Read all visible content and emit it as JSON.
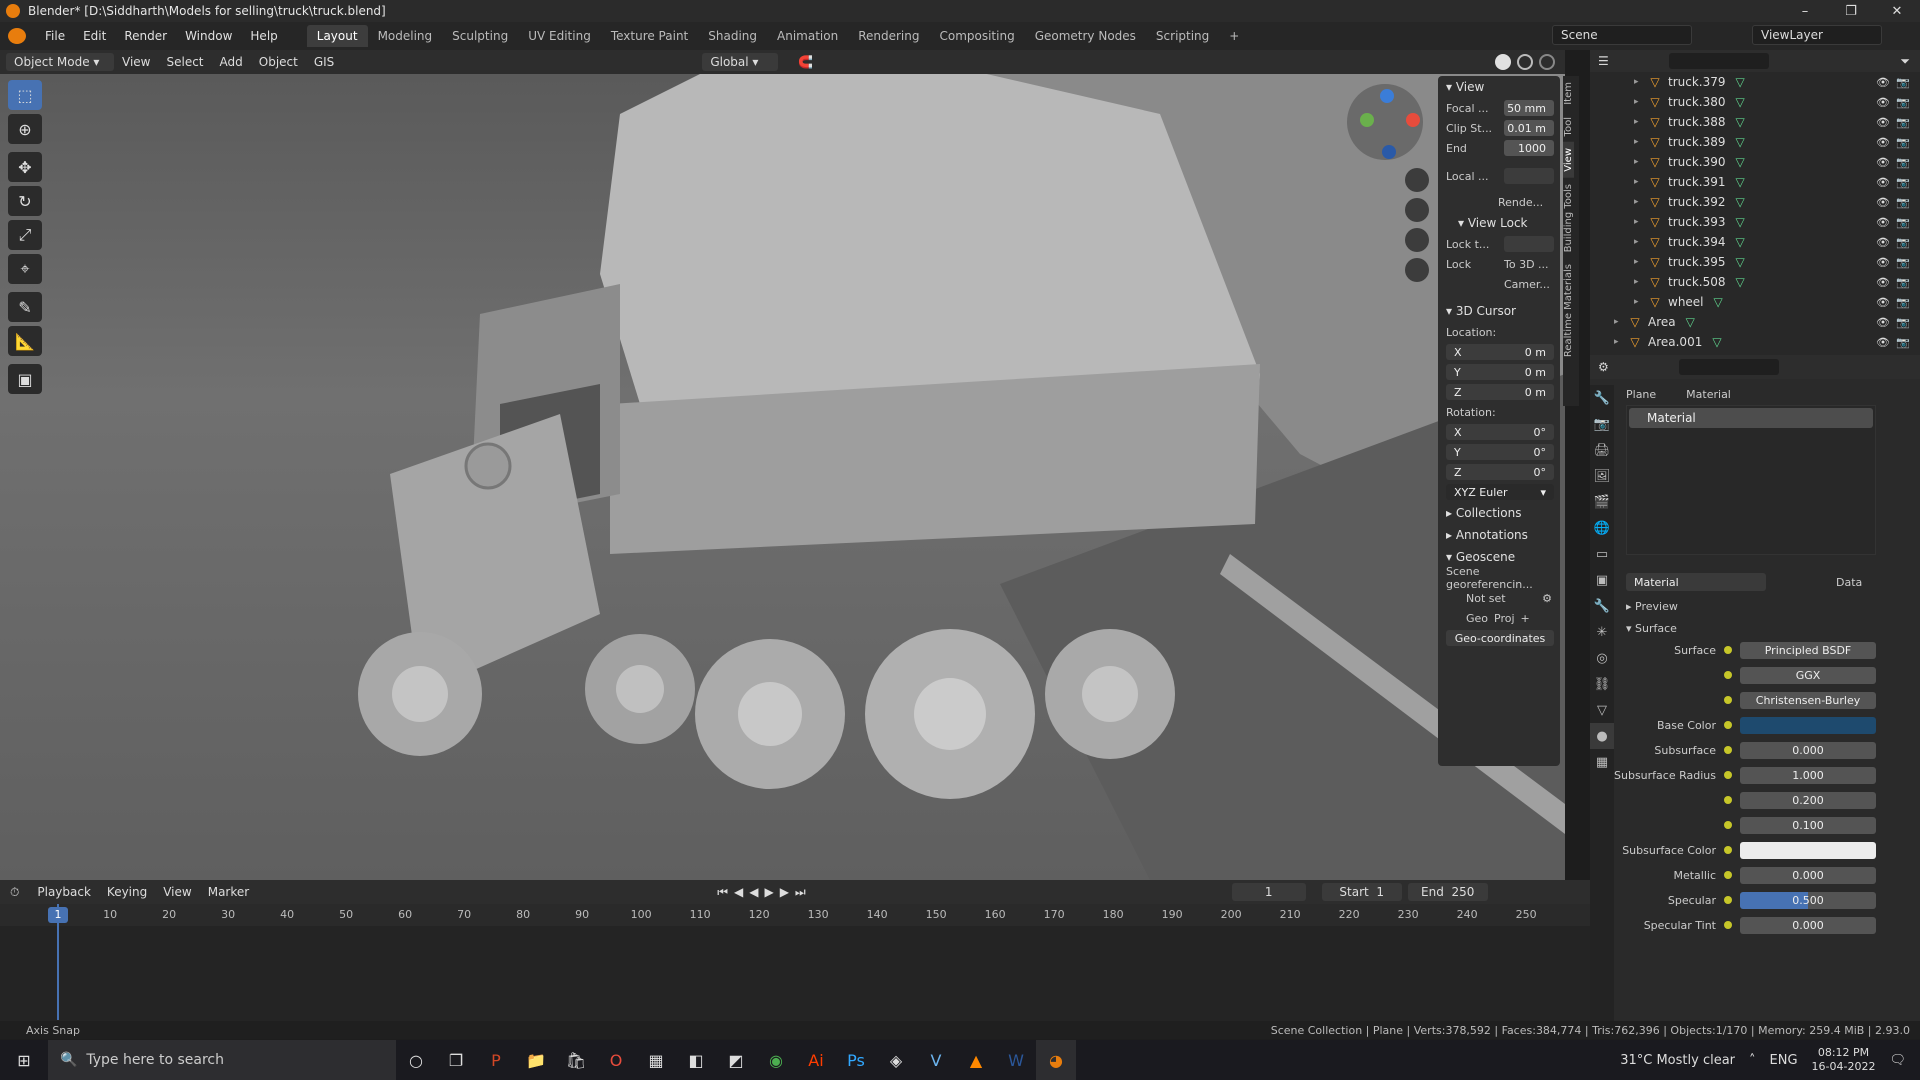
{
  "window": {
    "title": "Blender* [D:\\Siddharth\\Models for selling\\truck\\truck.blend]",
    "minimize": "–",
    "maximize": "❐",
    "close": "✕"
  },
  "menu": [
    "File",
    "Edit",
    "Render",
    "Window",
    "Help"
  ],
  "workspaces": [
    "Layout",
    "Modeling",
    "Sculpting",
    "UV Editing",
    "Texture Paint",
    "Shading",
    "Animation",
    "Rendering",
    "Compositing",
    "Geometry Nodes",
    "Scripting",
    "+"
  ],
  "scene": "Scene",
  "view_layer": "ViewLayer",
  "viewport_header": {
    "mode": "Object Mode",
    "items": [
      "View",
      "Select",
      "Add",
      "Object",
      "GIS"
    ],
    "orientation": "Global"
  },
  "npanel": {
    "view_title": "View",
    "focal_label": "Focal ...",
    "focal": "50 mm",
    "clip_start_label": "Clip St...",
    "clip_start": "0.01 m",
    "end_label": "End",
    "end": "1000",
    "local_label": "Local ...",
    "render_label": "Rende...",
    "view_lock_title": "View Lock",
    "lock_to_label": "Lock t...",
    "lock_label": "Lock",
    "to3d": "To 3D ...",
    "camera": "Camer...",
    "cursor_title": "3D Cursor",
    "location_label": "Location:",
    "x": "X",
    "y": "Y",
    "z": "Z",
    "loc_x": "0 m",
    "loc_y": "0 m",
    "loc_z": "0 m",
    "rotation_label": "Rotation:",
    "rot_x": "0°",
    "rot_y": "0°",
    "rot_z": "0°",
    "euler": "XYZ Euler",
    "collections": "Collections",
    "annotations": "Annotations",
    "geoscene": "Geoscene",
    "georef": "Scene georeferencin...",
    "notset": "Not set",
    "geo": "Geo",
    "proj": "Proj",
    "geocoords": "Geo-coordinates"
  },
  "sidetabs": [
    "Item",
    "Tool",
    "View",
    "Building Tools",
    "Realtime Materials"
  ],
  "outliner": [
    {
      "name": "truck.379"
    },
    {
      "name": "truck.380"
    },
    {
      "name": "truck.388"
    },
    {
      "name": "truck.389"
    },
    {
      "name": "truck.390"
    },
    {
      "name": "truck.391"
    },
    {
      "name": "truck.392"
    },
    {
      "name": "truck.393"
    },
    {
      "name": "truck.394"
    },
    {
      "name": "truck.395"
    },
    {
      "name": "truck.508"
    },
    {
      "name": "wheel"
    },
    {
      "name": "Area"
    },
    {
      "name": "Area.001"
    }
  ],
  "properties": {
    "breadcrumb_obj": "Plane",
    "breadcrumb_mat": "Material",
    "slot": "Material",
    "material_name": "Material",
    "link": "Data",
    "preview": "Preview",
    "surface_section": "Surface",
    "rows": [
      {
        "label": "Surface",
        "value": "Principled BSDF"
      },
      {
        "label": "",
        "value": "GGX"
      },
      {
        "label": "",
        "value": "Christensen-Burley"
      },
      {
        "label": "Base Color",
        "value": ""
      },
      {
        "label": "Subsurface",
        "value": "0.000"
      },
      {
        "label": "Subsurface Radius",
        "value": "1.000"
      },
      {
        "label": "",
        "value": "0.200"
      },
      {
        "label": "",
        "value": "0.100"
      },
      {
        "label": "Subsurface Color",
        "value": ""
      },
      {
        "label": "Metallic",
        "value": "0.000"
      },
      {
        "label": "Specular",
        "value": "0.500"
      },
      {
        "label": "Specular Tint",
        "value": "0.000"
      }
    ]
  },
  "timeline": {
    "items": [
      "Playback",
      "Keying",
      "View",
      "Marker"
    ],
    "current": "1",
    "start_label": "Start",
    "start": "1",
    "end_label": "End",
    "end": "250",
    "ticks": [
      "1",
      "10",
      "20",
      "30",
      "40",
      "50",
      "60",
      "70",
      "80",
      "90",
      "100",
      "110",
      "120",
      "130",
      "140",
      "150",
      "160",
      "170",
      "180",
      "190",
      "200",
      "210",
      "220",
      "230",
      "240",
      "250"
    ]
  },
  "status": {
    "left": "Axis Snap",
    "right": "Scene Collection | Plane | Verts:378,592 | Faces:384,774 | Tris:762,396 | Objects:1/170 | Memory: 259.4 MiB | 2.93.0"
  },
  "taskbar": {
    "search": "Type here to search",
    "weather": "31°C  Mostly clear",
    "lang": "ENG",
    "time": "08:12 PM",
    "date": "16-04-2022"
  }
}
